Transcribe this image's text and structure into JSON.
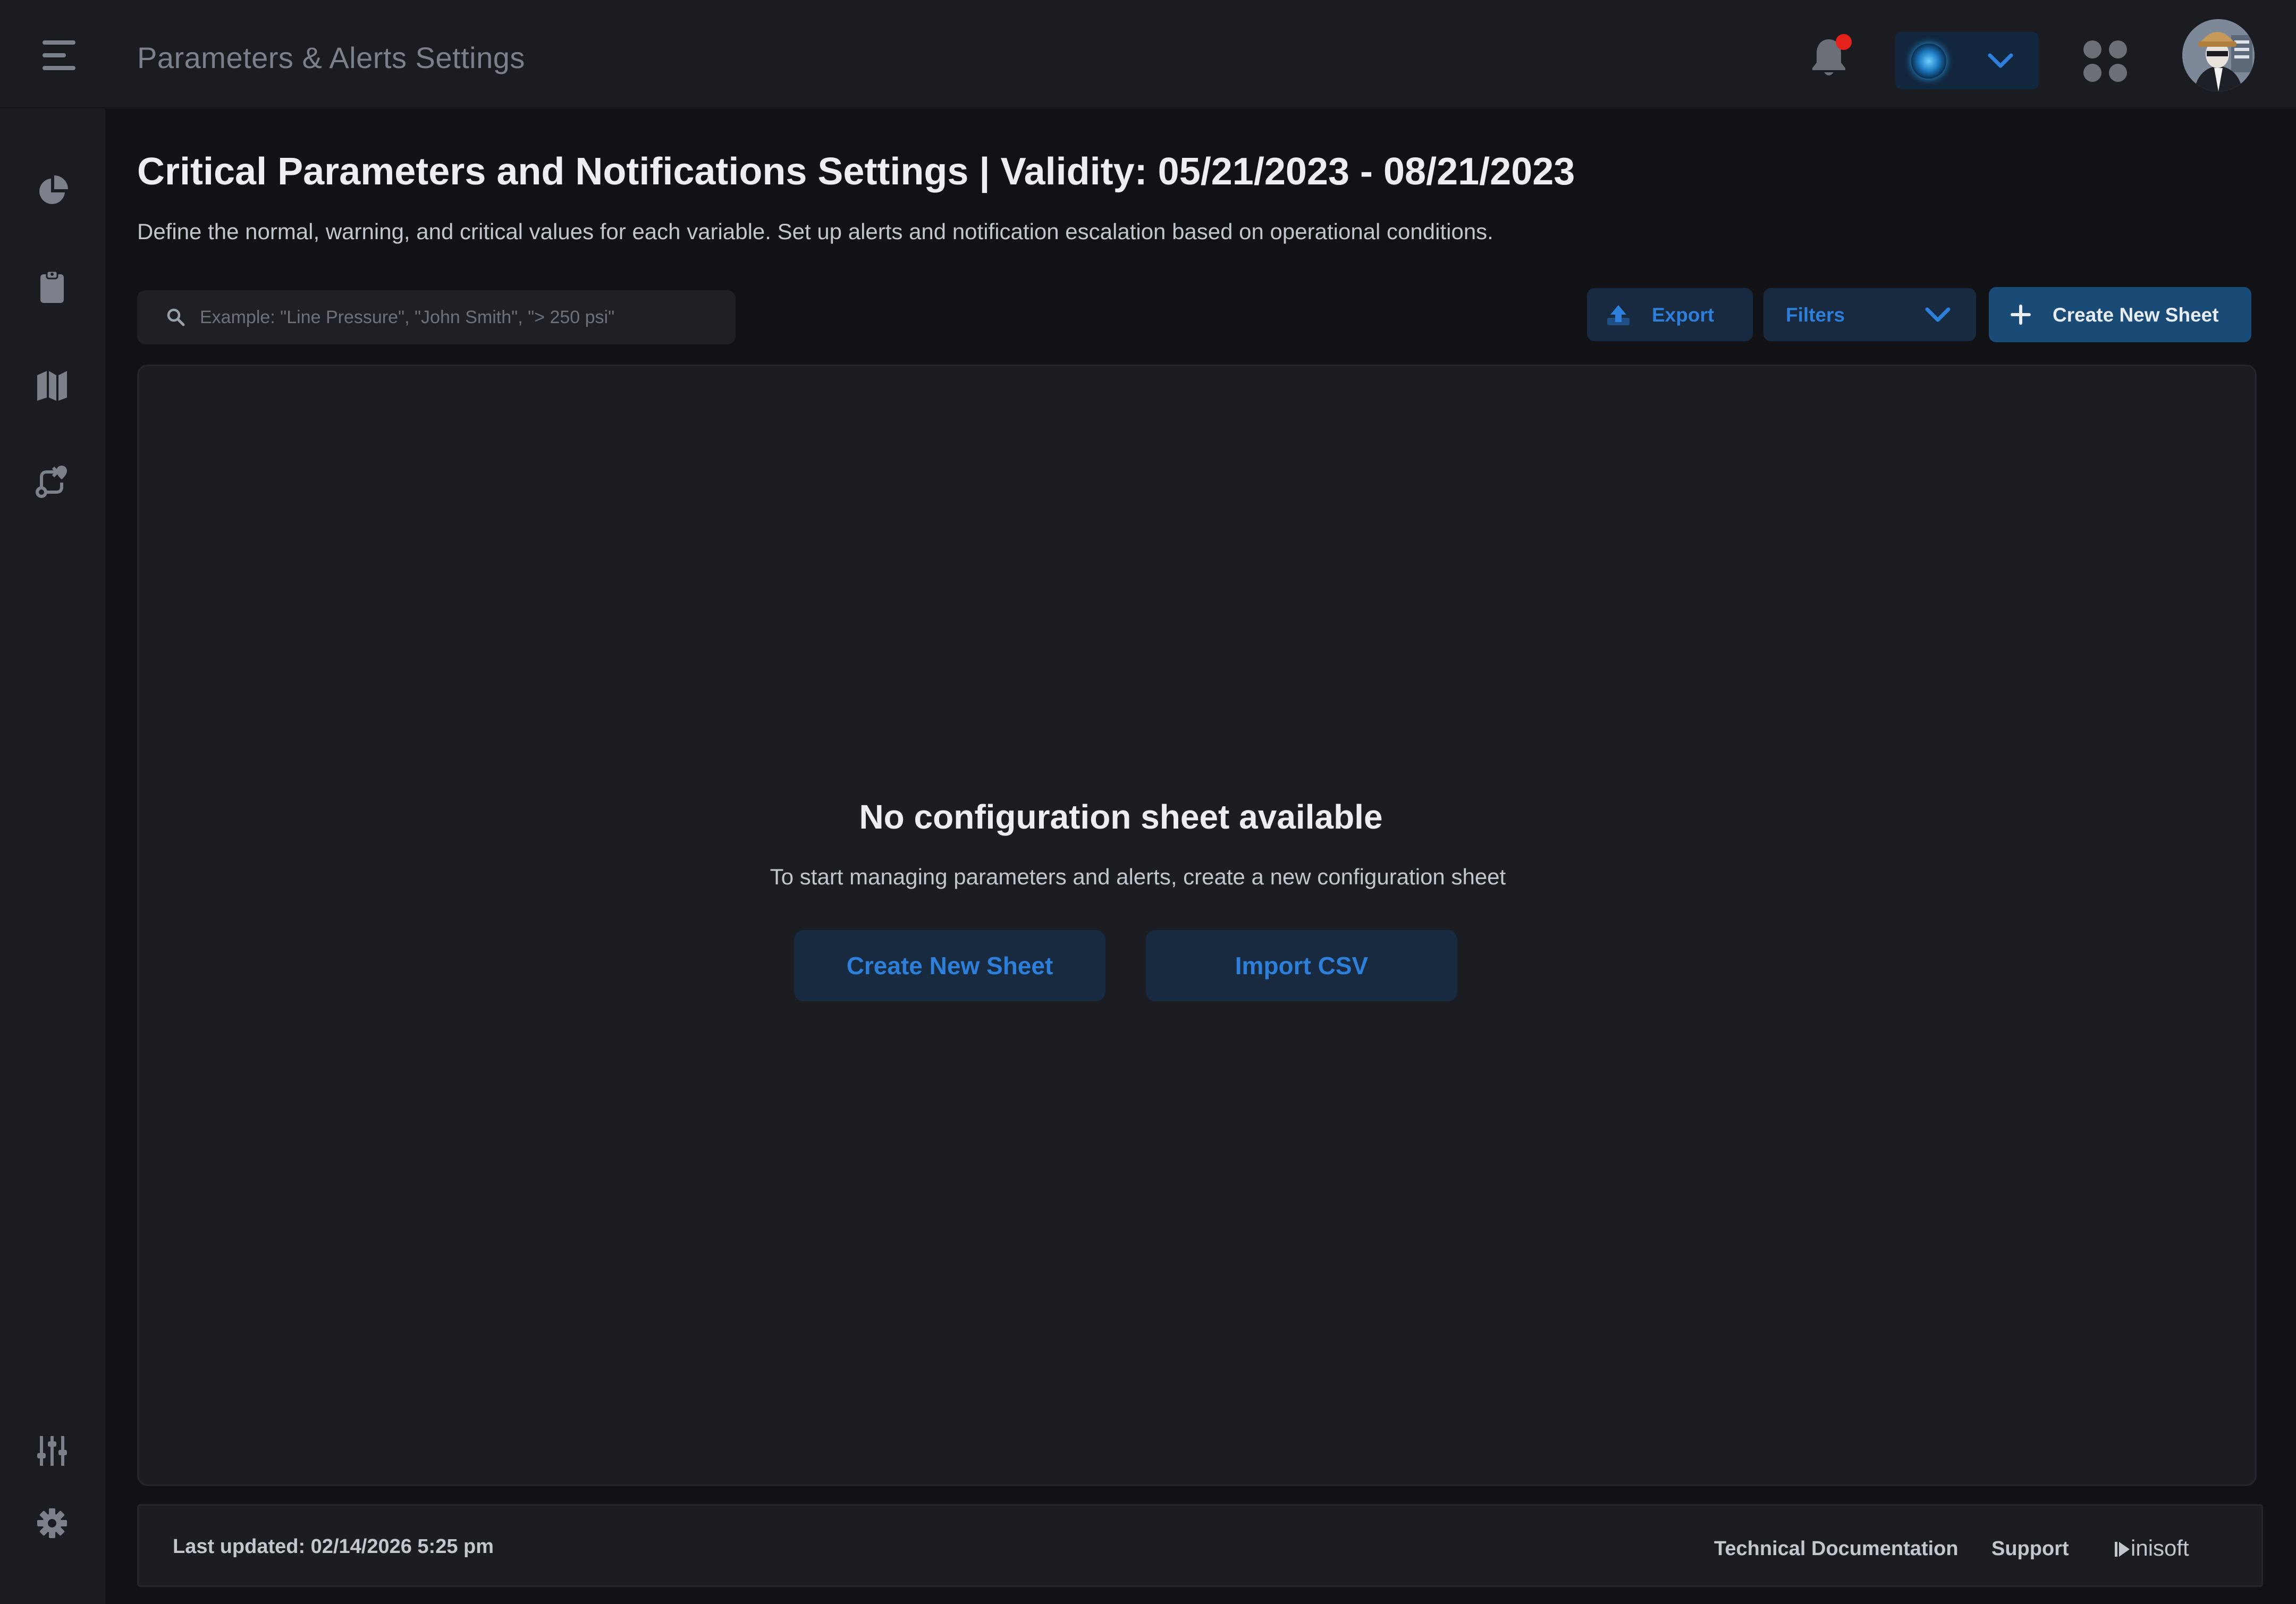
{
  "header": {
    "app_title": "Parameters & Alerts Settings",
    "notification_badge_color": "#e5211b"
  },
  "sidebar": {
    "top_items": [
      "pie-chart-icon",
      "clipboard-icon",
      "map-icon",
      "route-icon"
    ],
    "bottom_items": [
      "sliders-icon",
      "gear-icon"
    ]
  },
  "main": {
    "title": "Critical Parameters and Notifications Settings | Validity: 05/21/2023 - 08/21/2023",
    "description": "Define the normal, warning, and critical values for each variable. Set up alerts and notification escalation based on operational conditions.",
    "search": {
      "placeholder": "Example: \"Line Pressure\", \"John Smith\", \"> 250 psi\"",
      "value": ""
    },
    "toolbar": {
      "export_label": "Export",
      "filters_label": "Filters",
      "create_label": "Create New Sheet"
    },
    "empty_state": {
      "title": "No configuration sheet available",
      "subtitle": "To start managing parameters and alerts, create a new configuration sheet",
      "create_label": "Create New Sheet",
      "import_label": "Import CSV"
    }
  },
  "footer": {
    "last_updated": "Last updated: 02/14/2026 5:25 pm",
    "docs_link": "Technical Documentation",
    "support_link": "Support",
    "brand": "inisoft"
  },
  "colors": {
    "accent": "#2d7fd9",
    "primary_button": "#1a4b77",
    "background": "#111216",
    "surface": "#1b1d22"
  }
}
